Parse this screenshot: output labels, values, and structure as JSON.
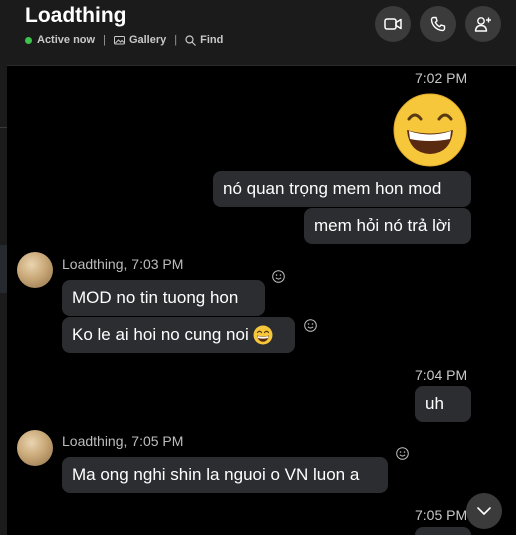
{
  "header": {
    "title": "Loadthing",
    "status": "Active now",
    "gallery_label": "Gallery",
    "find_label": "Find",
    "separator": "|"
  },
  "messages": {
    "time_1": "7:02 PM",
    "out_1": "nó quan trọng mem hon mod",
    "out_2": "mem hỏi nó trả lời",
    "sender_1": "Loadthing, 7:03 PM",
    "in_1": "MOD no tin tuong hon",
    "in_2": "Ko le ai hoi no cung noi",
    "time_2": "7:04 PM",
    "out_3": "uh",
    "sender_2": "Loadthing, 7:05 PM",
    "in_3": "Ma ong nghi shin la nguoi o VN luon a",
    "time_3": "7:05 PM"
  },
  "colors": {
    "background": "#000000",
    "header": "#1b1b1b",
    "bubble": "#2b2d31",
    "status_dot": "#3fc34f",
    "emoji": "#f6c73b"
  },
  "icons": [
    "video-call-icon",
    "phone-call-icon",
    "add-person-icon",
    "gallery-icon",
    "search-icon",
    "smiley-react-icon",
    "grinning-emoji-icon",
    "chevron-down-icon"
  ]
}
